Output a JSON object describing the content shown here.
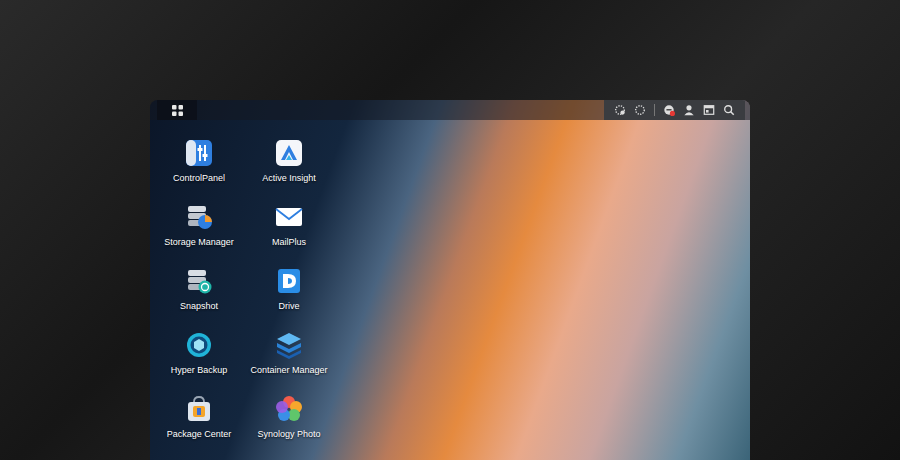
{
  "taskbar": {
    "notifications_unread": true
  },
  "desktop_icons": [
    {
      "label": "ControlPanel"
    },
    {
      "label": "Active Insight"
    },
    {
      "label": "Storage Manager"
    },
    {
      "label": "MailPlus"
    },
    {
      "label": "Snapshot"
    },
    {
      "label": "Drive"
    },
    {
      "label": "Hyper Backup"
    },
    {
      "label": "Container Manager"
    },
    {
      "label": "Package Center"
    },
    {
      "label": "Synology Photo"
    }
  ]
}
